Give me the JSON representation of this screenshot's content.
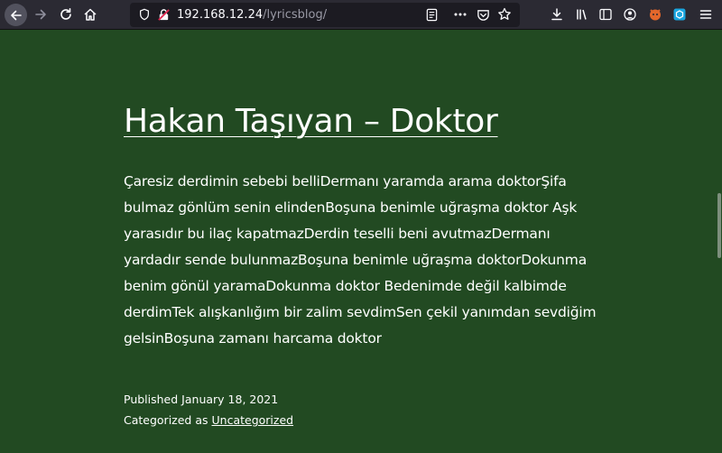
{
  "browser": {
    "url_host": "192.168.12.24",
    "url_path": "/lyricsblog/"
  },
  "post": {
    "title": "Hakan Taşıyan – Doktor",
    "body": "Çaresiz derdimin sebebi belliDermanı yaramda arama doktorŞifa bulmaz gönlüm senin elindenBoşuna benimle uğraşma doktor Aşk yarasıdır bu ilaç kapatmazDerdin teselli beni avutmazDermanı yardadır sende bulunmazBoşuna benimle uğraşma doktorDokunma benim gönül yaramaDokunma doktor Bedenimde değil kalbimde derdimTek alışkanlığım bir zalim sevdimSen çekil yanımdan sevdiğim gelsinBoşuna zamanı harcama doktor",
    "published_label": "Published",
    "published_date": "January 18, 2021",
    "category_label": "Categorized as",
    "category": "Uncategorized"
  },
  "colors": {
    "page_background": "#224a22",
    "toolbar_background": "#2b2a33",
    "urlbar_background": "#1c1b22"
  }
}
